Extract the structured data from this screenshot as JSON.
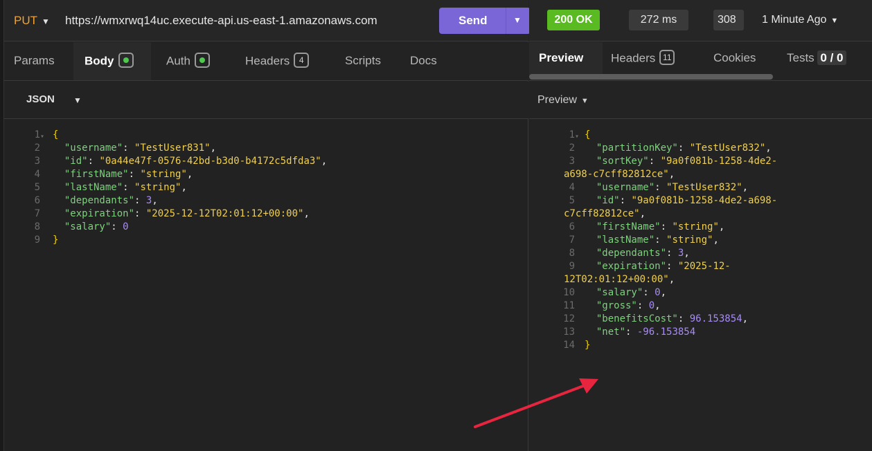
{
  "request": {
    "method": "PUT",
    "url": "https://wmxrwq14uc.execute-api.us-east-1.amazonaws.com",
    "send_label": "Send",
    "tabs": [
      {
        "label": "Params"
      },
      {
        "label": "Body"
      },
      {
        "label": "Auth"
      },
      {
        "label": "Headers",
        "count": "4"
      },
      {
        "label": "Scripts"
      },
      {
        "label": "Docs"
      }
    ],
    "body_type": "JSON",
    "body_lines": [
      {
        "n": "1",
        "open": "{"
      },
      {
        "n": "2",
        "key": "\"username\"",
        "val": "\"TestUser831\"",
        "type": "str",
        "comma": ","
      },
      {
        "n": "3",
        "key": "\"id\"",
        "val": "\"0a44e47f-0576-42bd-b3d0-b4172c5dfda3\"",
        "type": "str",
        "comma": ","
      },
      {
        "n": "4",
        "key": "\"firstName\"",
        "val": "\"string\"",
        "type": "str",
        "comma": ","
      },
      {
        "n": "5",
        "key": "\"lastName\"",
        "val": "\"string\"",
        "type": "str",
        "comma": ","
      },
      {
        "n": "6",
        "key": "\"dependants\"",
        "val": "3",
        "type": "num",
        "comma": ","
      },
      {
        "n": "7",
        "key": "\"expiration\"",
        "val": "\"2025-12-12T02:01:12+00:00\"",
        "type": "str",
        "comma": ","
      },
      {
        "n": "8",
        "key": "\"salary\"",
        "val": "0",
        "type": "num",
        "comma": ""
      },
      {
        "n": "9",
        "close": "}"
      }
    ]
  },
  "response": {
    "status": "200 OK",
    "time": "272 ms",
    "size": "308",
    "age": "1 Minute Ago",
    "tabs": [
      {
        "label": "Preview"
      },
      {
        "label": "Headers",
        "count": "11"
      },
      {
        "label": "Cookies"
      },
      {
        "label": "Tests",
        "score": "0 / 0"
      }
    ],
    "view_mode": "Preview",
    "lines": [
      {
        "n": "1",
        "seg": [
          {
            "t": "{",
            "c": "brace"
          }
        ]
      },
      {
        "n": "2",
        "seg": [
          {
            "t": "  \"partitionKey\"",
            "c": "key"
          },
          {
            "t": ": ",
            "c": "punc"
          },
          {
            "t": "\"TestUser832\"",
            "c": "str"
          },
          {
            "t": ",",
            "c": "punc"
          }
        ]
      },
      {
        "n": "3",
        "seg": [
          {
            "t": "  \"sortKey\"",
            "c": "key"
          },
          {
            "t": ": ",
            "c": "punc"
          },
          {
            "t": "\"9a0f081b-1258-4de2-",
            "c": "str"
          }
        ]
      },
      {
        "n": "",
        "seg": [
          {
            "t": "a698-c7cff82812ce\"",
            "c": "str"
          },
          {
            "t": ",",
            "c": "punc"
          }
        ]
      },
      {
        "n": "4",
        "seg": [
          {
            "t": "  \"username\"",
            "c": "key"
          },
          {
            "t": ": ",
            "c": "punc"
          },
          {
            "t": "\"TestUser832\"",
            "c": "str"
          },
          {
            "t": ",",
            "c": "punc"
          }
        ]
      },
      {
        "n": "5",
        "seg": [
          {
            "t": "  \"id\"",
            "c": "key"
          },
          {
            "t": ": ",
            "c": "punc"
          },
          {
            "t": "\"9a0f081b-1258-4de2-a698-",
            "c": "str"
          }
        ]
      },
      {
        "n": "",
        "seg": [
          {
            "t": "c7cff82812ce\"",
            "c": "str"
          },
          {
            "t": ",",
            "c": "punc"
          }
        ]
      },
      {
        "n": "6",
        "seg": [
          {
            "t": "  \"firstName\"",
            "c": "key"
          },
          {
            "t": ": ",
            "c": "punc"
          },
          {
            "t": "\"string\"",
            "c": "str"
          },
          {
            "t": ",",
            "c": "punc"
          }
        ]
      },
      {
        "n": "7",
        "seg": [
          {
            "t": "  \"lastName\"",
            "c": "key"
          },
          {
            "t": ": ",
            "c": "punc"
          },
          {
            "t": "\"string\"",
            "c": "str"
          },
          {
            "t": ",",
            "c": "punc"
          }
        ]
      },
      {
        "n": "8",
        "seg": [
          {
            "t": "  \"dependants\"",
            "c": "key"
          },
          {
            "t": ": ",
            "c": "punc"
          },
          {
            "t": "3",
            "c": "num"
          },
          {
            "t": ",",
            "c": "punc"
          }
        ]
      },
      {
        "n": "9",
        "seg": [
          {
            "t": "  \"expiration\"",
            "c": "key"
          },
          {
            "t": ": ",
            "c": "punc"
          },
          {
            "t": "\"2025-12-",
            "c": "str"
          }
        ]
      },
      {
        "n": "",
        "seg": [
          {
            "t": "12T02:01:12+00:00\"",
            "c": "str"
          },
          {
            "t": ",",
            "c": "punc"
          }
        ]
      },
      {
        "n": "10",
        "seg": [
          {
            "t": "  \"salary\"",
            "c": "key"
          },
          {
            "t": ": ",
            "c": "punc"
          },
          {
            "t": "0",
            "c": "num"
          },
          {
            "t": ",",
            "c": "punc"
          }
        ]
      },
      {
        "n": "11",
        "seg": [
          {
            "t": "  \"gross\"",
            "c": "key"
          },
          {
            "t": ": ",
            "c": "punc"
          },
          {
            "t": "0",
            "c": "num"
          },
          {
            "t": ",",
            "c": "punc"
          }
        ]
      },
      {
        "n": "12",
        "seg": [
          {
            "t": "  \"benefitsCost\"",
            "c": "key"
          },
          {
            "t": ": ",
            "c": "punc"
          },
          {
            "t": "96.153854",
            "c": "num"
          },
          {
            "t": ",",
            "c": "punc"
          }
        ]
      },
      {
        "n": "13",
        "seg": [
          {
            "t": "  \"net\"",
            "c": "key"
          },
          {
            "t": ": ",
            "c": "punc"
          },
          {
            "t": "-96.153854",
            "c": "num"
          }
        ]
      },
      {
        "n": "14",
        "seg": [
          {
            "t": "}",
            "c": "brace"
          }
        ]
      }
    ]
  },
  "annotation": {
    "arrow_color": "#e8253f"
  }
}
